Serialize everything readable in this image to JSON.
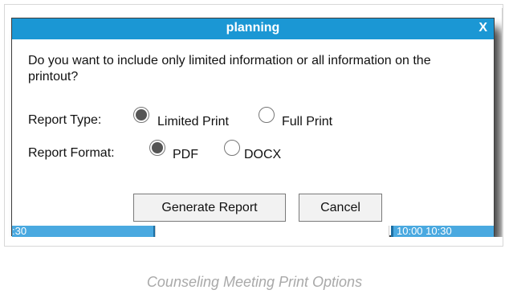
{
  "dialog": {
    "title": "planning",
    "close_label": "X",
    "question": "Do you want to include only limited information or all information on the printout?",
    "report_type": {
      "label": "Report Type:",
      "options": [
        "Limited Print",
        "Full Print"
      ],
      "selected": "Limited Print"
    },
    "report_format": {
      "label": "Report Format:",
      "options": [
        "PDF",
        "DOCX"
      ],
      "selected": "PDF"
    },
    "buttons": {
      "generate": "Generate Report",
      "cancel": "Cancel"
    }
  },
  "background": {
    "left_time": ":30",
    "right_time": "10:00  10:30"
  },
  "caption": "Counseling Meeting Print Options"
}
